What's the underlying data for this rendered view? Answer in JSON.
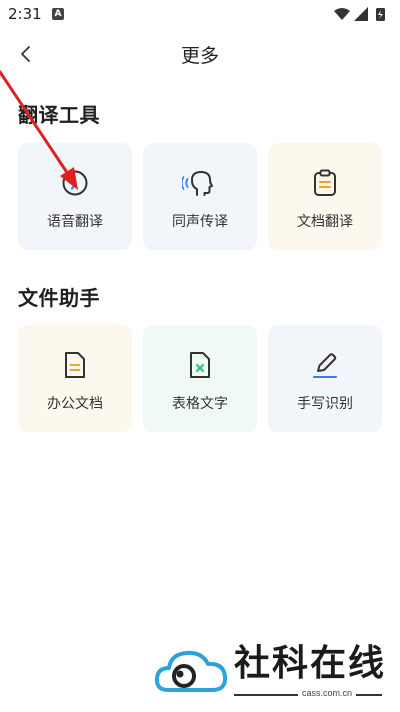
{
  "status_bar": {
    "time": "2:31",
    "notification_badge": "A"
  },
  "header": {
    "title": "更多",
    "back_icon": "chevron-left-icon"
  },
  "sections": [
    {
      "title": "翻译工具",
      "items": [
        {
          "label": "语音翻译",
          "icon": "voice-translate-icon",
          "bg": "#f2f6fb"
        },
        {
          "label": "同声传译",
          "icon": "speaking-head-icon",
          "bg": "#f2f6fb"
        },
        {
          "label": "文档翻译",
          "icon": "clipboard-icon",
          "bg": "#fdf8ed"
        }
      ]
    },
    {
      "title": "文件助手",
      "items": [
        {
          "label": "办公文档",
          "icon": "document-icon",
          "bg": "#fdf8ed"
        },
        {
          "label": "表格文字",
          "icon": "spreadsheet-icon",
          "bg": "#effaf5"
        },
        {
          "label": "手写识别",
          "icon": "pen-icon",
          "bg": "#f2f6fb"
        }
      ]
    }
  ],
  "watermark": {
    "brand": "社科在线",
    "url": "cass.com.cn"
  },
  "colors": {
    "accent_blue": "#2f7ff0",
    "accent_orange": "#f0a030",
    "accent_green": "#2bb673",
    "arrow_red": "#e02020"
  }
}
